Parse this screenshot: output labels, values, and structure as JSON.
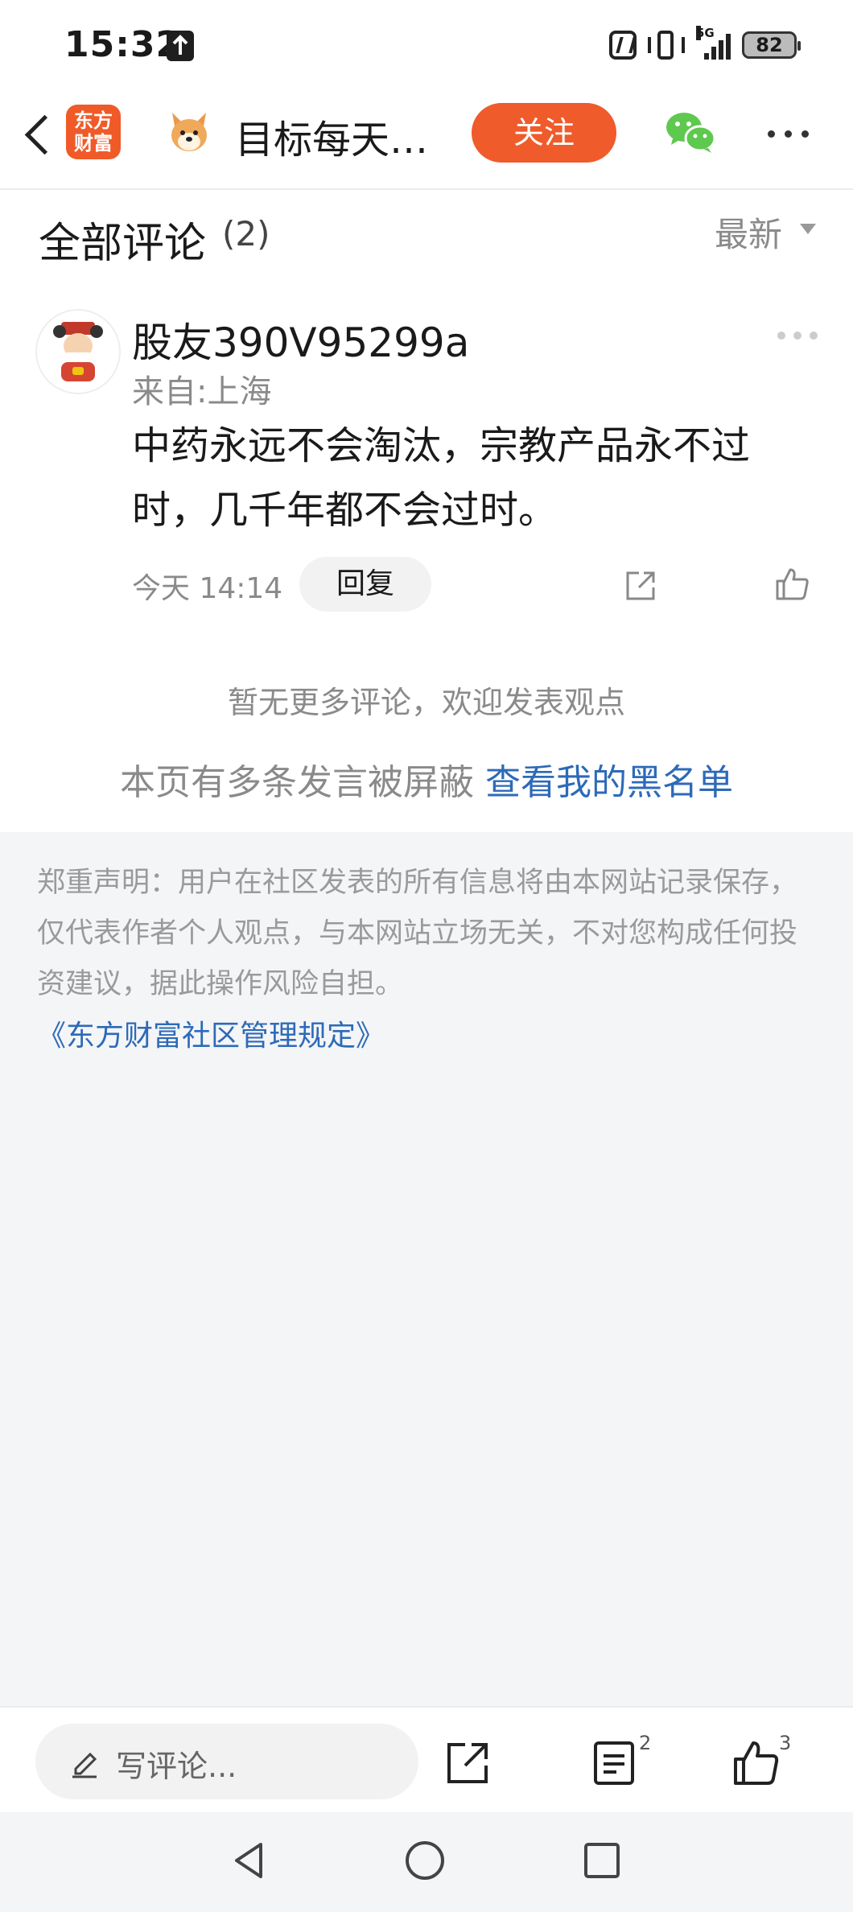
{
  "status_bar": {
    "time": "15:32",
    "network": "5G",
    "battery": "82"
  },
  "header": {
    "app_logo_text": "东方财富",
    "title": "目标每天…",
    "follow_label": "关注"
  },
  "comments_section": {
    "title": "全部评论",
    "count": "(2)",
    "sort_label": "最新"
  },
  "comment": {
    "username": "股友390V95299a",
    "location": "来自:上海",
    "text": "中药永远不会淘汰，宗教产品永不过时，几千年都不会过时。",
    "time": "今天 14:14",
    "reply_label": "回复"
  },
  "no_more_text": "暂无更多评论，欢迎发表观点",
  "blocked": {
    "prefix": "本页有多条发言被屏蔽 ",
    "link": "查看我的黑名单"
  },
  "disclaimer": {
    "text": "郑重声明：用户在社区发表的所有信息将由本网站记录保存，仅代表作者个人观点，与本网站立场无关，不对您构成任何投资建议，据此操作风险自担。",
    "rules_link": "《东方财富社区管理规定》"
  },
  "bottom_bar": {
    "write_placeholder": "写评论...",
    "comment_count": "2",
    "like_count": "3"
  },
  "colors": {
    "brand": "#ef5b2a",
    "link": "#2d6ab8",
    "wechat": "#5fc84f"
  }
}
